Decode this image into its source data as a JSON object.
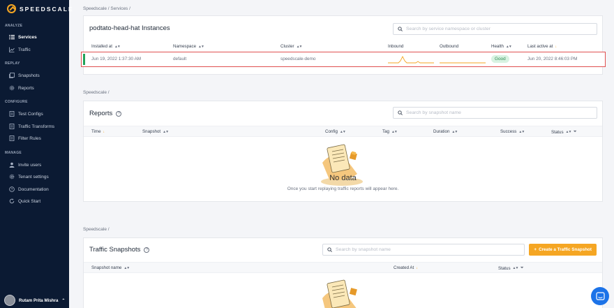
{
  "brand": {
    "name": "SPEEDSCALE"
  },
  "sidebar": {
    "sections": {
      "analyze": "ANALYZE",
      "replay": "REPLAY",
      "configure": "CONFIGURE",
      "manage": "MANAGE"
    },
    "items": {
      "services": "Services",
      "traffic": "Traffic",
      "snapshots": "Snapshots",
      "reports": "Reports",
      "test_configs": "Test Configs",
      "traffic_transforms": "Traffic Transforms",
      "filter_rules": "Filter Rules",
      "invite_users": "Invite users",
      "tenant_settings": "Tenant settings",
      "documentation": "Documentation",
      "quick_start": "Quick Start"
    },
    "user": {
      "name": "Rutam Prita Mishra"
    }
  },
  "instances": {
    "breadcrumb": "Speedscale  /  Services  /",
    "title": "podtato-head-hat Instances",
    "search_placeholder": "Search by service namespace or cluster",
    "columns": {
      "installed_at": "Installed at",
      "namespace": "Namespace",
      "cluster": "Cluster",
      "inbound": "Inbound",
      "outbound": "Outbound",
      "health": "Health",
      "last_active": "Last active at"
    },
    "row": {
      "installed_at": "Jun 19, 2022 1:37:30 AM",
      "namespace": "default",
      "cluster": "speedscale-demo",
      "health": "Good",
      "last_active": "Jun 20, 2022 8:46:03 PM"
    }
  },
  "reports": {
    "breadcrumb": "Speedscale  /",
    "title": "Reports",
    "search_placeholder": "Search by snapshot name",
    "columns": {
      "time": "Time",
      "snapshot": "Snapshot",
      "config": "Config",
      "tag": "Tag",
      "duration": "Duration",
      "success": "Success",
      "status": "Status"
    },
    "empty_title": "No data",
    "empty_message": "Once you start replaying traffic reports will appear here."
  },
  "snapshots": {
    "breadcrumb": "Speedscale  /",
    "title": "Traffic Snapshots",
    "search_placeholder": "Search by snapshot name",
    "create_button": "Create a Traffic Snapshot",
    "columns": {
      "snapshot_name": "Snapshot name",
      "created_at": "Created At",
      "status": "Status"
    }
  },
  "colors": {
    "sidebar_bg": "#0b1a33",
    "accent": "#f5a623",
    "health_good": "#2f8a52",
    "chat": "#1c73e8"
  }
}
